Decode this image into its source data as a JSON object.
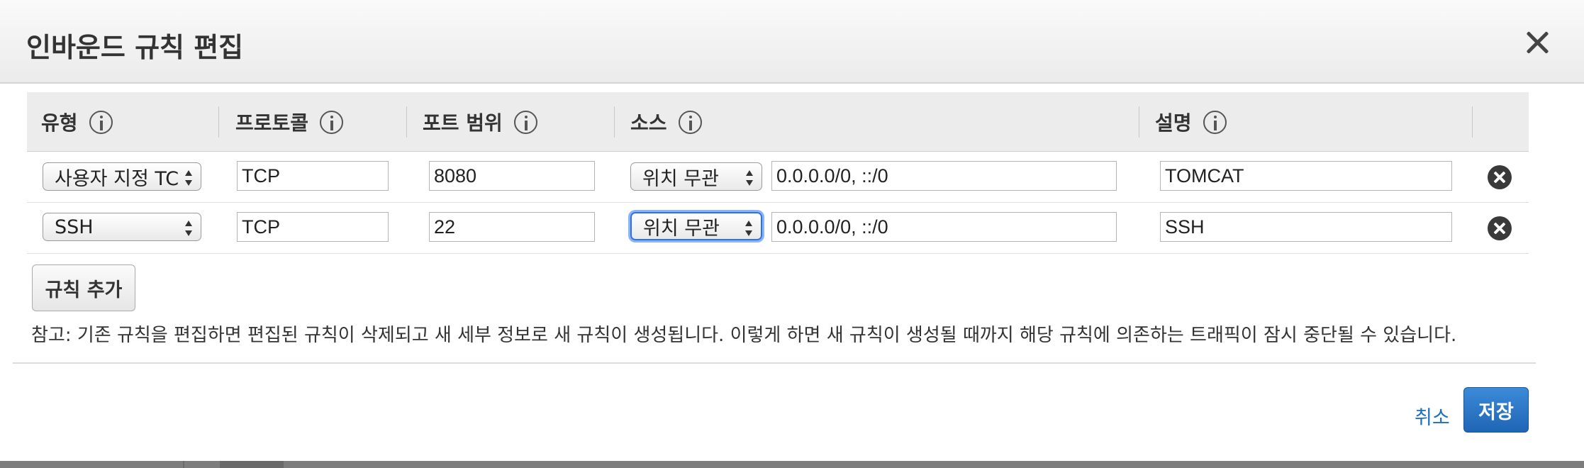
{
  "dialog": {
    "title": "인바운드 규칙 편집"
  },
  "table": {
    "headers": {
      "type": "유형",
      "protocol": "프로토콜",
      "port_range": "포트 범위",
      "source": "소스",
      "description": "설명"
    },
    "rows": [
      {
        "type": "사용자 지정 TC",
        "protocol": "TCP",
        "port_range": "8080",
        "source_type": "위치 무관",
        "source_value": "0.0.0.0/0, ::/0",
        "description": "TOMCAT"
      },
      {
        "type": "SSH",
        "protocol": "TCP",
        "port_range": "22",
        "source_type": "위치 무관",
        "source_value": "0.0.0.0/0, ::/0",
        "description": "SSH"
      }
    ]
  },
  "add_rule_label": "규칙 추가",
  "note": "참고: 기존 규칙을 편집하면 편집된 규칙이 삭제되고 새 세부 정보로 새 규칙이 생성됩니다. 이렇게 하면 새 규칙이 생성될 때까지 해당 규칙에 의존하는 트래픽이 잠시 중단될 수 있습니다.",
  "footer": {
    "cancel_label": "취소",
    "save_label": "저장"
  },
  "colors": {
    "accent": "#1f66b5",
    "link": "#1a6fc4",
    "focus": "#2f70e6"
  }
}
